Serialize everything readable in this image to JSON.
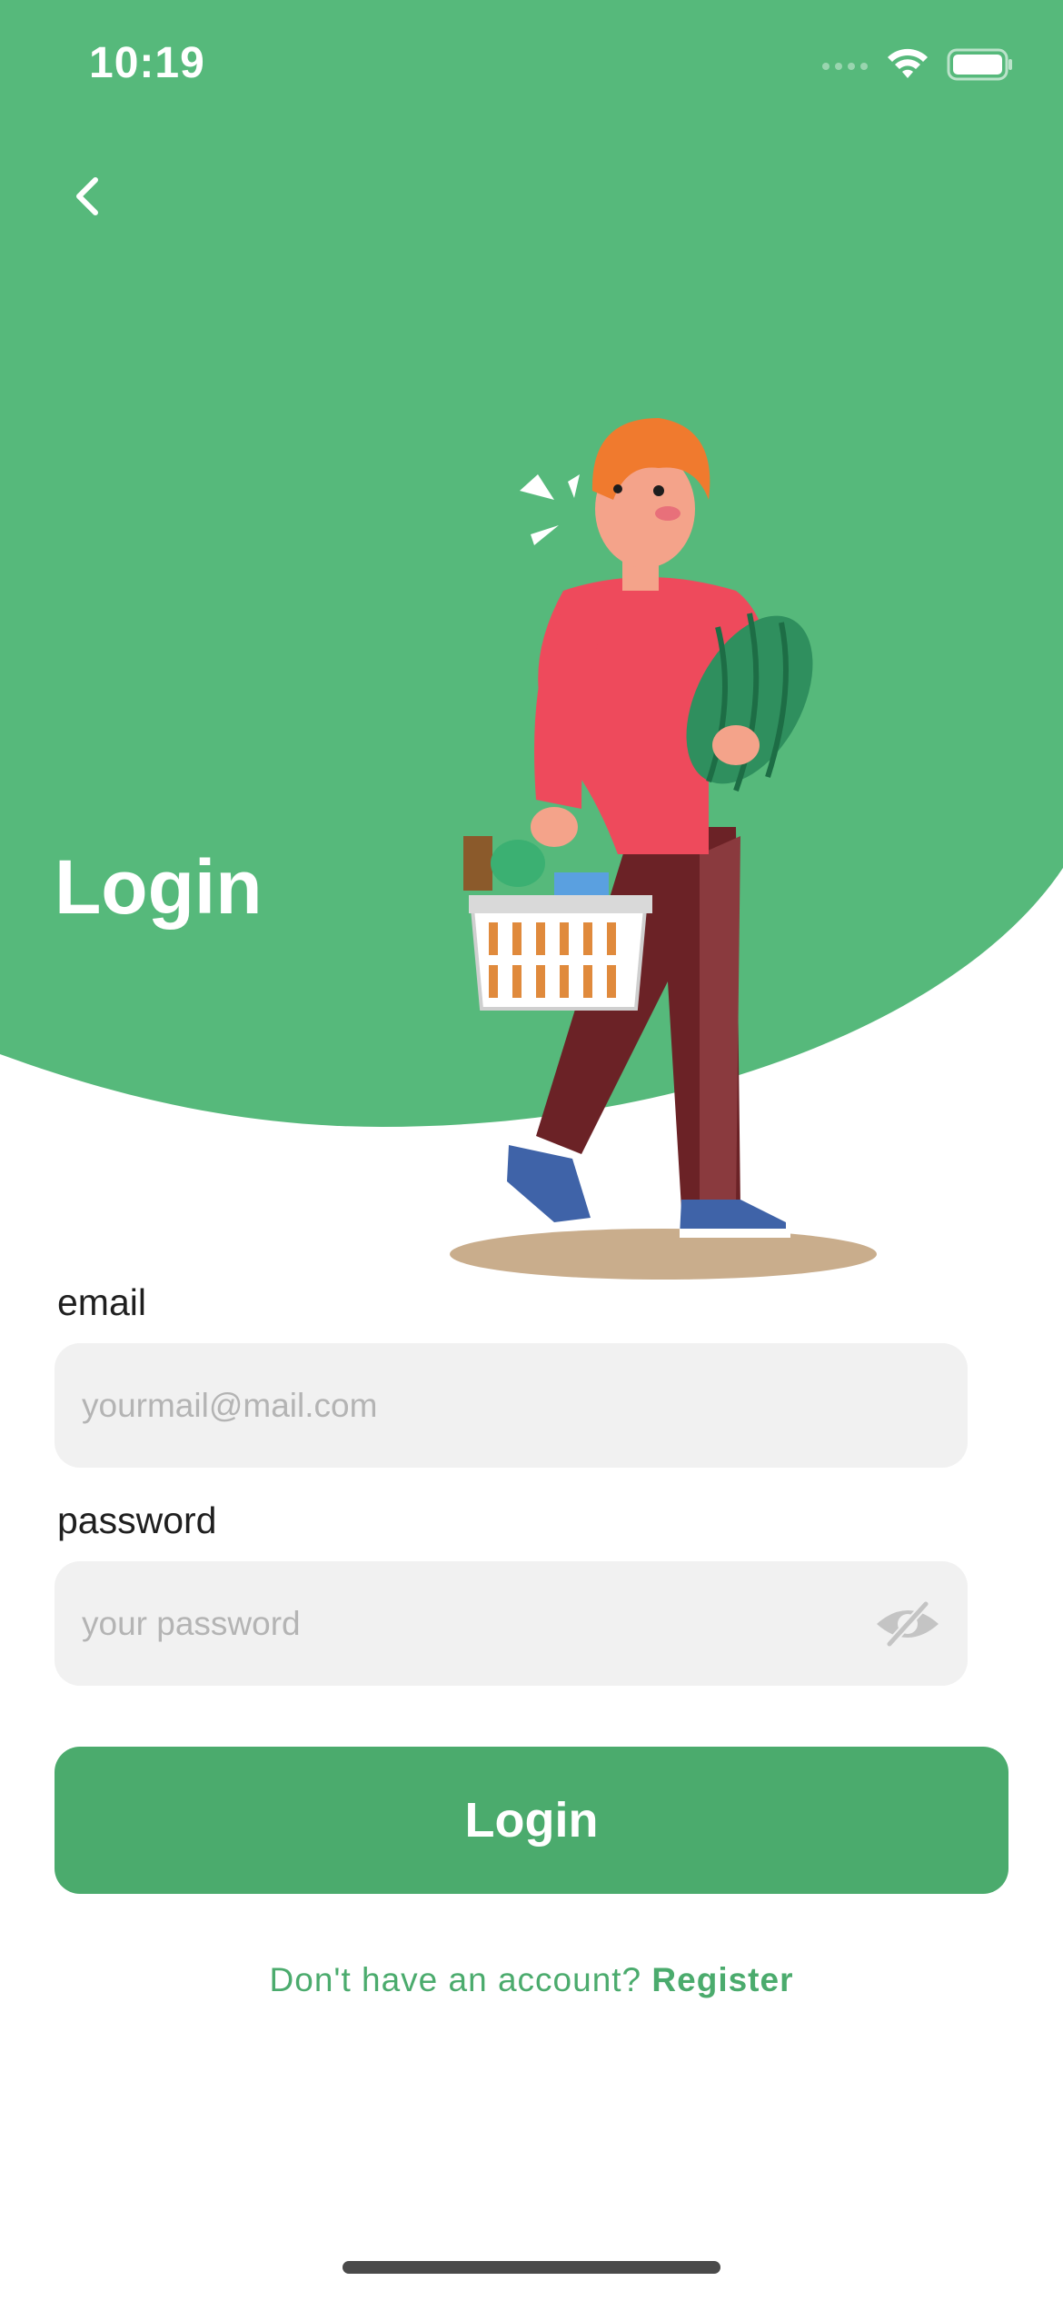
{
  "status_bar": {
    "time": "10:19"
  },
  "header": {
    "title": "Login",
    "back_icon": "chevron-left-icon"
  },
  "form": {
    "email_label": "email",
    "email_placeholder": "yourmail@mail.com",
    "email_value": "",
    "password_label": "password",
    "password_placeholder": "your password",
    "password_value": "",
    "password_toggle_icon": "eye-slash-icon",
    "submit_label": "Login"
  },
  "footer": {
    "prompt": "Don't have an account? ",
    "register_label": "Register"
  },
  "colors": {
    "brand_green": "#56b97b",
    "button_green": "#4bab6d",
    "input_bg": "#f1f1f1"
  }
}
